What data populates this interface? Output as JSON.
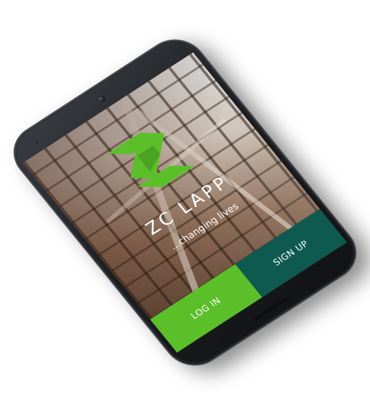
{
  "app": {
    "name": "ZC LAPP",
    "tagline": "...changing lives",
    "brand_color": "#5bbf2a",
    "secondary_color": "#0e5a50"
  },
  "actions": {
    "login_label": "LOG IN",
    "signup_label": "SIGN UP"
  },
  "icons": {
    "logo": "z-logo-icon",
    "camera": "front-camera-icon"
  }
}
